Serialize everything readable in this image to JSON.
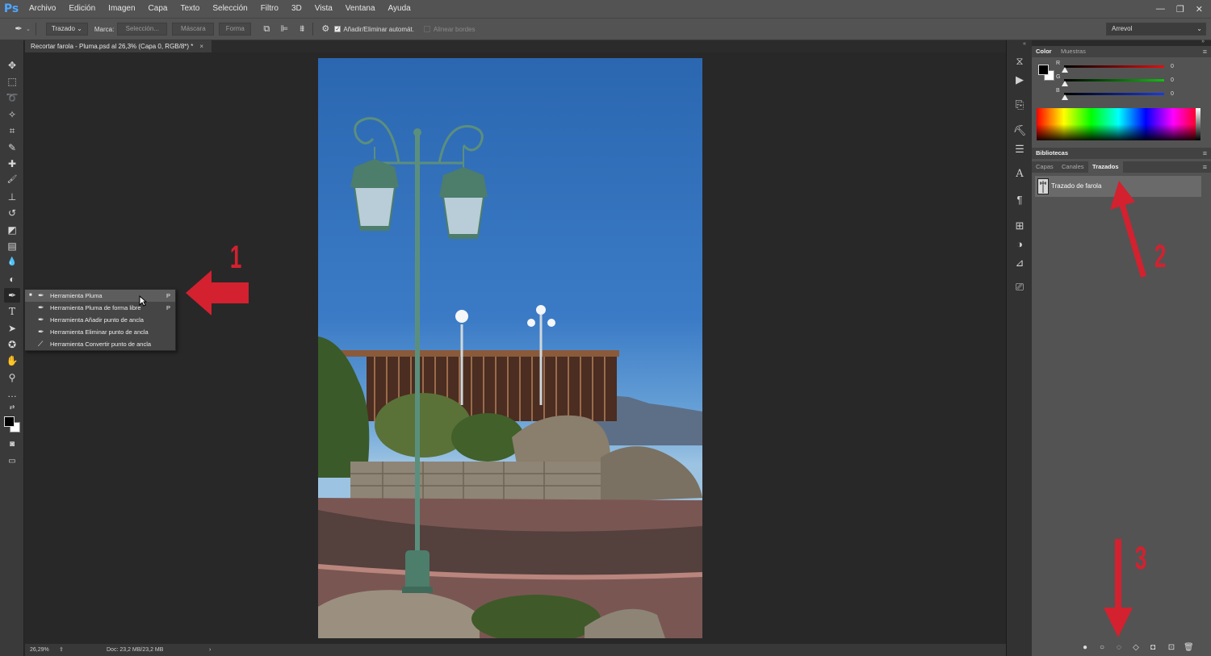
{
  "app": {
    "logo": "Ps"
  },
  "menu": [
    "Archivo",
    "Edición",
    "Imagen",
    "Capa",
    "Texto",
    "Selección",
    "Filtro",
    "3D",
    "Vista",
    "Ventana",
    "Ayuda"
  ],
  "window_controls": [
    "—",
    "❐",
    "✕"
  ],
  "options": {
    "mode": "Trazado",
    "marca_label": "Marca:",
    "seleccion": "Selección...",
    "mascara": "Máscara",
    "forma": "Forma",
    "auto_add_delete": "Añadir/Eliminar automát.",
    "auto_add_delete_checked": true,
    "align_edges": "Alinear bordes",
    "workspace": "Arrevol"
  },
  "document": {
    "tab_title": "Recortar farola - Pluma.psd al 26,3% (Capa 0, RGB/8*) *",
    "tab_close": "×",
    "zoom": "26,29%",
    "doc_info": "Doc: 23,2 MB/23,2 MB"
  },
  "tools": [
    {
      "name": "move-tool-icon",
      "glyph": "✥"
    },
    {
      "name": "marquee-tool-icon",
      "glyph": "⬚"
    },
    {
      "name": "lasso-tool-icon",
      "glyph": "➰"
    },
    {
      "name": "quick-selection-tool-icon",
      "glyph": "✧"
    },
    {
      "name": "crop-tool-icon",
      "glyph": "⌗"
    },
    {
      "name": "eyedropper-tool-icon",
      "glyph": "✎"
    },
    {
      "name": "healing-brush-tool-icon",
      "glyph": "✚"
    },
    {
      "name": "brush-tool-icon",
      "glyph": "🖌"
    },
    {
      "name": "clone-stamp-tool-icon",
      "glyph": "⊥"
    },
    {
      "name": "history-brush-tool-icon",
      "glyph": "↺"
    },
    {
      "name": "eraser-tool-icon",
      "glyph": "◩"
    },
    {
      "name": "gradient-tool-icon",
      "glyph": "▤"
    },
    {
      "name": "blur-tool-icon",
      "glyph": "💧"
    },
    {
      "name": "dodge-tool-icon",
      "glyph": "◐"
    },
    {
      "name": "pen-tool-icon",
      "glyph": "✒"
    },
    {
      "name": "type-tool-icon",
      "glyph": "T"
    },
    {
      "name": "path-selection-tool-icon",
      "glyph": "➤"
    },
    {
      "name": "custom-shape-tool-icon",
      "glyph": "✪"
    },
    {
      "name": "hand-tool-icon",
      "glyph": "✋"
    },
    {
      "name": "zoom-tool-icon",
      "glyph": "⚲"
    },
    {
      "name": "more-tools-icon",
      "glyph": "…"
    }
  ],
  "pen_flyout": [
    {
      "label": "Herramienta Pluma",
      "key": "P",
      "selected": true
    },
    {
      "label": "Herramienta Pluma de forma libre",
      "key": "P",
      "selected": false
    },
    {
      "label": "Herramienta Añadir punto de ancla",
      "key": "",
      "selected": false
    },
    {
      "label": "Herramienta Eliminar punto de ancla",
      "key": "",
      "selected": false
    },
    {
      "label": "Herramienta Convertir punto de ancla",
      "key": "",
      "selected": false
    }
  ],
  "color_panel": {
    "tabs": [
      "Color",
      "Muestras"
    ],
    "sliders": [
      {
        "label": "R",
        "value": "0",
        "color": "#e01010"
      },
      {
        "label": "G",
        "value": "0",
        "color": "#10c010"
      },
      {
        "label": "B",
        "value": "0",
        "color": "#1a3ae0"
      }
    ]
  },
  "libraries_tab": "Bibliotecas",
  "layers_panel": {
    "tabs": [
      "Capas",
      "Canales",
      "Trazados"
    ],
    "active_tab": "Trazados",
    "paths": [
      "Trazado de farola"
    ]
  },
  "annotations": {
    "one": "1",
    "two": "2",
    "three": "3",
    "color": "#d3212f"
  }
}
